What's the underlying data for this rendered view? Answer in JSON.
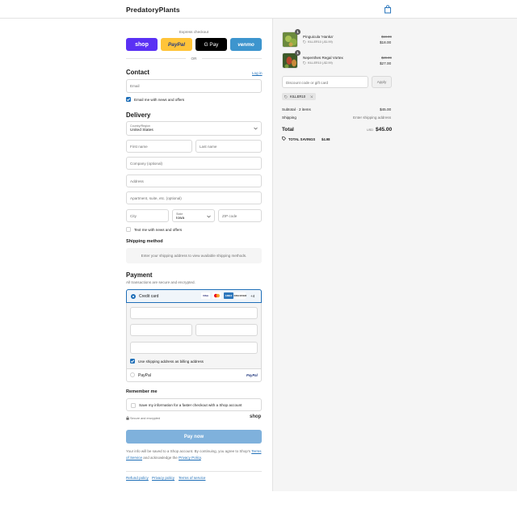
{
  "header": {
    "logo": "PredatoryPlants",
    "cart_icon": "bag-icon"
  },
  "express": {
    "title": "Express checkout",
    "buttons": [
      {
        "label": "shop",
        "color": "#5a31f4"
      },
      {
        "label": "PayPal",
        "color": "#ffc439"
      },
      {
        "label": "G Pay",
        "color": "#000000"
      },
      {
        "label": "venmo",
        "color": "#3d95ce"
      }
    ],
    "or": "OR"
  },
  "contact": {
    "title": "Contact",
    "login": "Log in",
    "email_placeholder": "Email",
    "email_news": "Email me with news and offers"
  },
  "delivery": {
    "title": "Delivery",
    "country_label": "Country/Region",
    "country_value": "United States",
    "first_name": "First name",
    "last_name": "Last name",
    "company": "Company (optional)",
    "address": "Address",
    "apartment": "Apartment, suite, etc. (optional)",
    "city": "City",
    "state_label": "State",
    "state_value": "Iowa",
    "zip": "ZIP code",
    "text_news": "Text me with news and offers"
  },
  "shipping": {
    "title": "Shipping method",
    "notice": "Enter your shipping address to view available shipping methods."
  },
  "payment": {
    "title": "Payment",
    "subtitle": "All transactions are secure and encrypted.",
    "credit_card": "Credit card",
    "card_brands": [
      "VISA",
      "MC",
      "AMEX",
      "DISCOVER"
    ],
    "more_brands": "+4",
    "billing_same": "Use shipping address as billing address",
    "paypal": "PayPal",
    "paypal_logo": "PayPal"
  },
  "remember": {
    "title": "Remember me",
    "save_info": "Save my information for a faster checkout with a Shop account",
    "secure": "Secure and encrypted",
    "shop_logo": "shop"
  },
  "pay_button": "Pay now",
  "legal": {
    "line1": "Your info will be saved to a Shop account. By continuing, you agree to Shop's",
    "terms": "Terms of Service",
    "and": "and acknowledge the",
    "privacy": "Privacy Policy",
    "period": "."
  },
  "footer": {
    "links": [
      "Refund policy",
      "Privacy policy",
      "Terms of service"
    ]
  },
  "summary": {
    "items": [
      {
        "qty": "1",
        "name": "Pinguicula 'Hanka'",
        "discount": "KILLER10 (-$1.99)",
        "old_price": "$19.99",
        "price": "$18.00"
      },
      {
        "qty": "1",
        "name": "Nepenthes Regal Vortex",
        "discount": "KILLER10 (-$2.99)",
        "old_price": "$29.99",
        "price": "$27.00"
      }
    ],
    "discount_placeholder": "Discount code or gift card",
    "apply": "Apply",
    "applied_code": "KILLER10",
    "subtotal_label": "Subtotal · 2 items",
    "subtotal": "$45.00",
    "shipping_label": "Shipping",
    "shipping_value": "Enter shipping address",
    "total_label": "Total",
    "currency": "USD",
    "total": "$45.00",
    "savings_label": "TOTAL SAVINGS",
    "savings": "$4.98"
  }
}
